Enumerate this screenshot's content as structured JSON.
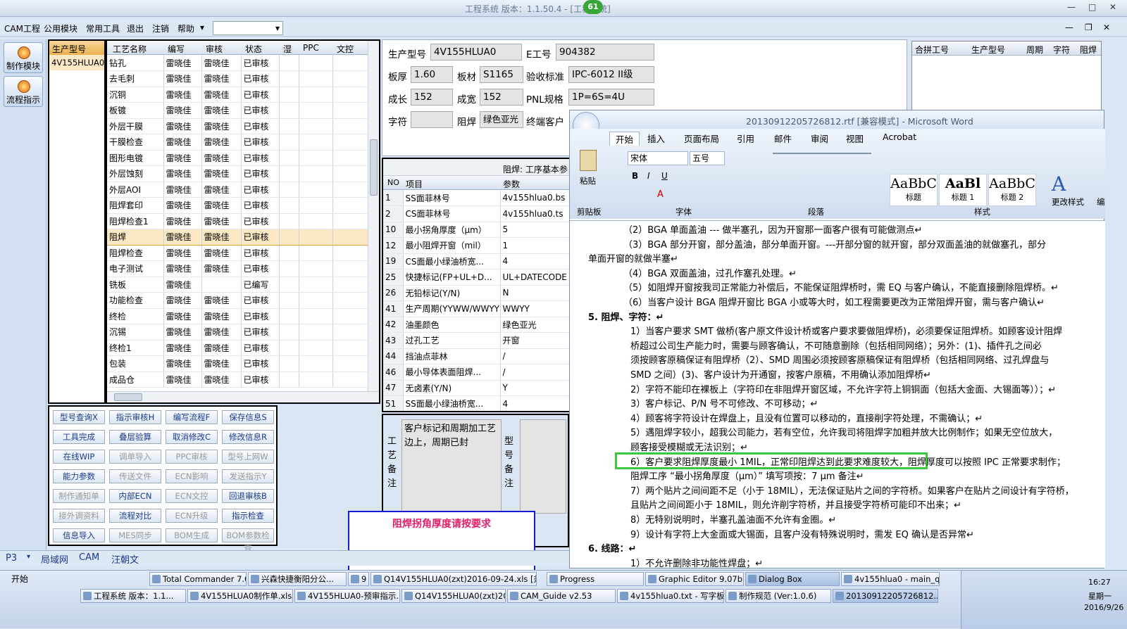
{
  "app": {
    "title": "工程系统  版本：1.1.50.4 - [工程系统]",
    "badge": "61",
    "min": "—",
    "max": "□",
    "close": "✕",
    "mdi_min": "—",
    "mdi_restore": "❐",
    "mdi_close": "✕"
  },
  "menu": {
    "items": [
      "CAM工程",
      "公用模块",
      "常用工具",
      "退出",
      "注销",
      "帮助"
    ],
    "help_arrow": "▾",
    "select_arrow": "▾"
  },
  "nav": {
    "items": [
      "制作模块",
      "流程指示"
    ]
  },
  "model_list": {
    "header": "生产型号",
    "rows": [
      "4V155HLUA0"
    ]
  },
  "process": {
    "headers": [
      "工艺名称",
      "编写",
      "审核",
      "状态",
      "湿",
      "PPC",
      "文控"
    ],
    "rows": [
      [
        "钻孔",
        "雷晓佳",
        "雷晓佳",
        "已审核"
      ],
      [
        "去毛刺",
        "雷晓佳",
        "雷晓佳",
        "已审核"
      ],
      [
        "沉铜",
        "雷晓佳",
        "雷晓佳",
        "已审核"
      ],
      [
        "板镀",
        "雷晓佳",
        "雷晓佳",
        "已审核"
      ],
      [
        "外层干膜",
        "雷晓佳",
        "雷晓佳",
        "已审核"
      ],
      [
        "干膜检查",
        "雷晓佳",
        "雷晓佳",
        "已审核"
      ],
      [
        "图形电镀",
        "雷晓佳",
        "雷晓佳",
        "已审核"
      ],
      [
        "外层蚀刻",
        "雷晓佳",
        "雷晓佳",
        "已审核"
      ],
      [
        "外层AOI",
        "雷晓佳",
        "雷晓佳",
        "已审核"
      ],
      [
        "阻焊套印",
        "雷晓佳",
        "雷晓佳",
        "已审核"
      ],
      [
        "阻焊检查1",
        "雷晓佳",
        "雷晓佳",
        "已审核"
      ],
      [
        "阻焊",
        "雷晓佳",
        "雷晓佳",
        "已审核"
      ],
      [
        "阻焊检查",
        "雷晓佳",
        "雷晓佳",
        "已审核"
      ],
      [
        "电子测试",
        "雷晓佳",
        "雷晓佳",
        "已审核"
      ],
      [
        "铣板",
        "雷晓佳",
        "",
        "已编写"
      ],
      [
        "功能检查",
        "雷晓佳",
        "雷晓佳",
        "已审核"
      ],
      [
        "终检",
        "雷晓佳",
        "雷晓佳",
        "已审核"
      ],
      [
        "沉锡",
        "雷晓佳",
        "雷晓佳",
        "已审核"
      ],
      [
        "终检1",
        "雷晓佳",
        "雷晓佳",
        "已审核"
      ],
      [
        "包装",
        "雷晓佳",
        "雷晓佳",
        "已审核"
      ],
      [
        "成品仓",
        "雷晓佳",
        "雷晓佳",
        "已审核"
      ]
    ],
    "selected_index": 11
  },
  "buttons": [
    "型号查询X",
    "指示审核H",
    "编写流程F",
    "保存信息S",
    "工具完成",
    "叠层验算",
    "取消修改C",
    "修改信息R",
    "在线WIP",
    "调单导入",
    "PPC审核",
    "型号上网W",
    "能力参数",
    "传送文件",
    "ECN影响",
    "发送指示Y",
    "制作通知单",
    "内部ECN",
    "ECN文控",
    "回退审核B",
    "接外调资料",
    "流程对比",
    "ECN升级",
    "指示检查",
    "信息导入",
    "MES同步",
    "BOM生成",
    "BOM参数检查"
  ],
  "disabled_buttons": [
    9,
    10,
    11,
    13,
    14,
    15,
    16,
    18,
    20,
    22,
    25,
    26,
    27
  ],
  "info": {
    "model_label": "生产型号",
    "model": "4V155HLUA0",
    "eno_label": "E工号",
    "eno": "904382",
    "thick_label": "板厚",
    "thick": "1.60",
    "mat_label": "板材",
    "mat": "S1165",
    "std_label": "验收标准",
    "std": "IPC-6012 II级",
    "len_label": "成长",
    "len": "152",
    "wid_label": "成宽",
    "wid": "152",
    "pnl_label": "PNL规格",
    "pnl": "1P=6S=4U",
    "char_label": "字符",
    "char": "",
    "mask_label": "阻焊",
    "mask": "绿色亚光",
    "cust_label": "终端客户"
  },
  "merge": {
    "headers": [
      "合拼工号",
      "生产型号",
      "周期",
      "字符",
      "阻焊"
    ]
  },
  "param": {
    "title": "阻焊: 工序基本参",
    "headers": [
      "NO",
      "项目",
      "参数"
    ],
    "rows": [
      [
        "1",
        "SS面菲林号",
        "4v155hlua0.bs"
      ],
      [
        "2",
        "CS面菲林号",
        "4v155hlua0.ts"
      ],
      [
        "10",
        "最小拐角厚度（μm）",
        "5"
      ],
      [
        "12",
        "最小阻焊开窗（mil）",
        "1"
      ],
      [
        "19",
        "CS面最小绿油桥宽...",
        "4"
      ],
      [
        "25",
        "快捷标记(FP+UL+D...",
        "UL+DATECODE"
      ],
      [
        "26",
        "无铅标记(Y/N)",
        "N"
      ],
      [
        "41",
        "生产周期(YYWW/WWYY)",
        "WWYY"
      ],
      [
        "42",
        "油墨颜色",
        "绿色亚光"
      ],
      [
        "43",
        "过孔工艺",
        "开窗"
      ],
      [
        "44",
        "挡油点菲林",
        "/"
      ],
      [
        "46",
        "最小导体表面阻焊...",
        "/"
      ],
      [
        "47",
        "无卤素(Y/N)",
        "Y"
      ],
      [
        "51",
        "SS面最小绿油桥宽...",
        "4"
      ]
    ]
  },
  "notes": {
    "label": "工艺备注",
    "text": "客户标记和周期加工艺边上，周期已封",
    "label2": "型号备注"
  },
  "popup": {
    "text": "阻焊拐角厚度请按要求"
  },
  "bottom": {
    "p3": "P3",
    "tabs": [
      "局域网",
      "CAM",
      "汪朝文"
    ]
  },
  "word": {
    "title": "20130912205726812.rtf [兼容模式] - Microsoft Word",
    "tabs": [
      "开始",
      "插入",
      "页面布局",
      "引用",
      "邮件",
      "审阅",
      "视图",
      "Acrobat"
    ],
    "font": "宋体",
    "size": "五号",
    "paste": "粘贴",
    "clipboard": "剪贴板",
    "font_group": "字体",
    "para_group": "段落",
    "style_group": "样式",
    "styles": [
      {
        "sample": "AaBbC",
        "name": "标题"
      },
      {
        "sample": "AaBl",
        "name": "标题 1"
      },
      {
        "sample": "AaBbC",
        "name": "标题 2"
      }
    ],
    "change_style": "更改样式",
    "edit": "编",
    "lines": [
      "（2）BGA 单面盖油 --- 做半塞孔，因为开窗那一面客户很有可能做测点↵",
      "（3）BGA 部分开窗，部分盖油，部分单面开窗。---开部分窗的就开窗，部分双面盖油的就做塞孔，部分",
      "单面开窗的就做半塞↵",
      "（4）BGA 双面盖油，过孔作塞孔处理。↵",
      "（5）如阻焊开窗按我司正常能力补偿后，不能保证阻焊桥时，需 EQ 与客户确认，不能直接删除阻焊桥。↵",
      "（6）当客户设计 BGA 阻焊开窗比 BGA 小或等大时，如工程需要更改为正常阻焊开窗，需与客户确认↵",
      "5.   阻焊、字符：↵",
      "1）当客户要求 SMT 做桥(客户原文件设计桥或客户要求要做阻焊桥)，必须要保证阻焊桥。如顾客设计阻焊",
      "桥超过公司生产能力时，需要与顾客确认，不可随意删除（包括相同网络）；另外：(1)、插件孔之间必",
      "须按顾客原稿保证有阻焊桥（2）、SMD 周围必须按顾客原稿保证有阻焊桥（包括相同网络、过孔焊盘与",
      "SMD 之间）(3)、客户设计为开通窗，按客户原稿，不用确认添加阻焊桥↵",
      "2）字符不能印在裸板上（字符印在非阻焊开窗区域，不允许字符上铜铜面（包括大金面、大锡面等））；↵",
      "3）客户标记、P/N 号不可修改、不可移动；↵",
      "4）顾客将字符设计在焊盘上，且没有位置可以移动的，直接削字符处理，不需确认；↵",
      "5）遇阻焊字较小，超我公司能力，若有空位，允许我司将阻焊字加粗并放大比例制作；如果无空位放大，",
      "顾客接受模糊或无法识别；↵",
      "6）客户要求阻焊厚度最小 1MIL，正常印阻焊达到此要求难度较大，阻焊厚度可以按照 IPC 正常要求制作；",
      "阻焊工序 “最小拐角厚度（μm）” 填写项按：7   μm 备注↵",
      "7）两个贴片之间间距不足（小于 18MIL），无法保证贴片之间的字符桥。如果客户在贴片之间设计有字符桥，",
      "且贴片之间间距小于 18MIL，则允许削字符桥，并且接受字符桥可能印不出来；↵",
      "8）无特别说明时，半塞孔盖油面不允许有金圈。↵",
      "9）设计有字符上大金面或大锡面，且客户没有特殊说明时，需发 EQ 确认是否异常↵",
      "6.   线路：↵",
      "1）不允许删除非功能性焊盘；↵"
    ]
  },
  "taskbar": {
    "start": "开始",
    "row1": [
      "Total Commander 7.0...",
      "兴森快捷衡阳分公...",
      "9",
      "Q14V155HLUA0(zxt)2016-09-24.xls [兼容模式]",
      "Progress",
      "Graphic Editor 9.07b...",
      "Dialog Box",
      "4v155hlua0 - main_qa"
    ],
    "row2": [
      "工程系统  版本：1.1...",
      "4V155HLUA0制作单.xls...",
      "4V155HLUA0-预审指示...",
      "Q14V155HLUA0(zxt)20...",
      "CAM_Guide v2.53",
      "4v155hlua0.txt - 写字板",
      "制作规范 (Ver:1.0.6)",
      "20130912205726812..."
    ],
    "time": "16:27",
    "weekday": "星期一",
    "date": "2016/9/26"
  },
  "colors": {
    "accent": "#2060c0",
    "highlight_green": "#3cc83c",
    "popup_border": "#1a1ad0",
    "popup_text": "#e0206e",
    "selected_row": "#fbe8c4"
  }
}
